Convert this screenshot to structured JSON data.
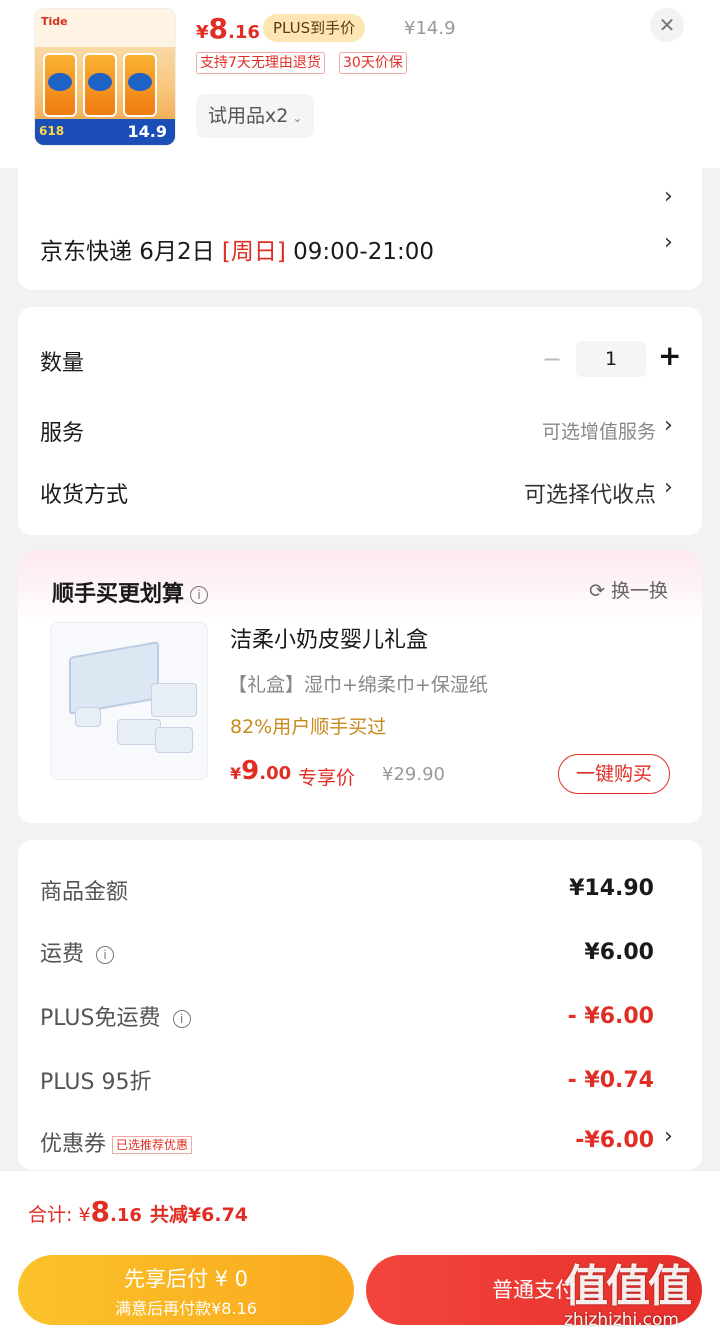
{
  "product": {
    "image_text": "首款针对纳米级污渍洗衣液 无机白T恤混洗污渍 价保618 抢14.9",
    "price_currency": "¥",
    "price_int": "8",
    "price_dec": ".16",
    "plus_tag": "PLUS到手价",
    "original_price": "¥14.9",
    "policies": [
      "支持7天无理由退货",
      "30天价保"
    ],
    "sku": "试用品x2",
    "close_glyph": "✕"
  },
  "delivery": {
    "text_prefix": "京东快递 6月2日 ",
    "weekday": "[周日]",
    "time": " 09:00-21:00"
  },
  "options": {
    "quantity_label": "数量",
    "quantity_value": "1",
    "minus": "−",
    "plus": "+",
    "service_label": "服务",
    "service_value": "可选增值服务",
    "receive_label": "收货方式",
    "receive_value": "可选择代收点"
  },
  "recommend": {
    "title": "顺手买更划算",
    "refresh": "换一换",
    "name": "洁柔小奶皮婴儿礼盒",
    "desc": "【礼盒】湿巾+绵柔巾+保湿纸",
    "bought": "82%用户顺手买过",
    "price_currency": "¥",
    "price_int": "9",
    "price_dec": ".00",
    "price_tag": "专享价",
    "original_price": "¥29.90",
    "buy_button": "一键购买"
  },
  "summary": {
    "rows": [
      {
        "label": "商品金额",
        "value": "¥14.90"
      },
      {
        "label": "运费",
        "value": "¥6.00"
      },
      {
        "label": "PLUS免运费",
        "value": "- ¥6.00"
      },
      {
        "label": "PLUS 95折",
        "value": "- ¥0.74"
      },
      {
        "label": "优惠券",
        "badge": "已选推荐优惠",
        "value": "-¥6.00"
      }
    ]
  },
  "footer": {
    "total_label": "合计: ¥",
    "total_int": "8",
    "total_dec": ".16",
    "save": "共减¥6.74",
    "later_line1": "先享后付 ¥ 0",
    "later_line2": "满意后再付款¥8.16",
    "pay_button": "普通支付"
  },
  "watermark": {
    "mark": "值值值",
    "site": "zhizhizhi.com"
  },
  "colors": {
    "accent": "#e02e24",
    "plus_bg": "#fde6b4",
    "later_btn": "#f9a91d",
    "gold_text": "#c78a1b"
  }
}
